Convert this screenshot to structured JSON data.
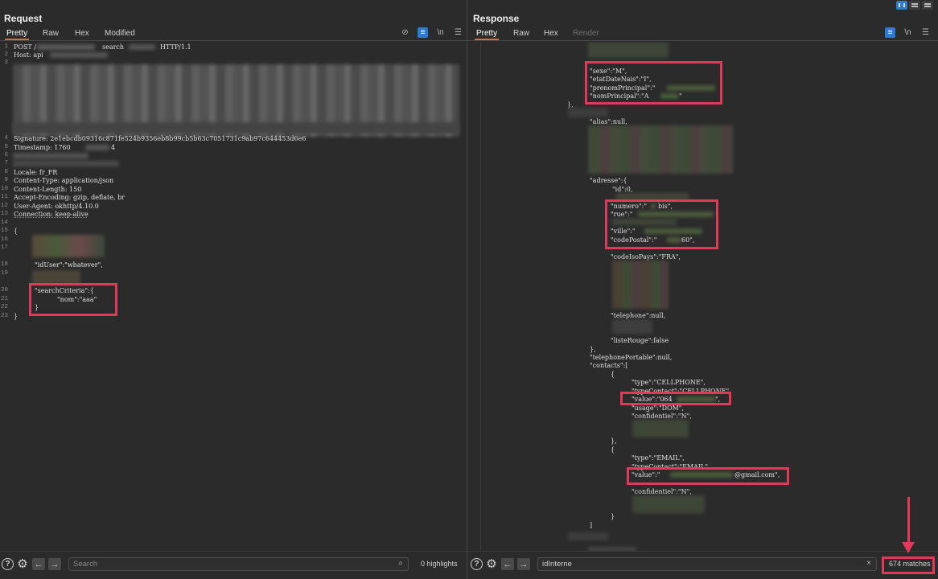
{
  "request": {
    "title": "Request",
    "tabs": [
      "Pretty",
      "Raw",
      "Hex",
      "Modified"
    ],
    "lines": {
      "l1": "POST /",
      "l1b": "search",
      "l1c": "HTTP/1.1",
      "l2": "Host: api",
      "l4": "Signature: 2e1ebcdb09316c871fe524b9356eb8b99cb5b63c7051731c9ab97c644453d6e6",
      "l5a": "Timestamp: 1760",
      "l5b": "4",
      "l8": "Locale: fr_FR",
      "l9": "Content-Type: application/json",
      "l10": "Content-Length: 150",
      "l11": "Accept-Encoding: gzip, deflate, br",
      "l12": "User-Agent: okhttp/4.10.0",
      "l13": "Connection: keep-alive",
      "l15": "{",
      "l18": "\"idUser\":\"whatever\",",
      "l20": "\"searchCriteria\":{",
      "l21": "\"nom\":\"aaa\"",
      "l22": "}",
      "l23": "}"
    },
    "line_numbers": [
      "1",
      "2",
      "3",
      "4",
      "5",
      "6",
      "7",
      "8",
      "9",
      "10",
      "11",
      "12",
      "13",
      "14",
      "15",
      "16",
      "17",
      "18",
      "19",
      "20",
      "21",
      "22",
      "23"
    ],
    "footer": {
      "search_placeholder": "Search",
      "highlights": "0 highlights"
    }
  },
  "response": {
    "title": "Response",
    "tabs": [
      "Pretty",
      "Raw",
      "Hex",
      "Render"
    ],
    "lines": {
      "sexe": "\"sexe\":\"M\",",
      "etat": "\"etatDateNais\":\"I\",",
      "prenom": "\"prenomPrincipal\":\"",
      "nom": "\"nomPrincipal\":\"A",
      "nom_end": "\"",
      "close1": "},",
      "alias": "\"alias\":null,",
      "adresse": "\"adresse\":{",
      "id": "\"id\":0,",
      "numero": "\"numero\":\"",
      "numero_b": "bis\",",
      "rue": "\"rue\":\"",
      "ville": "\"ville\":\"",
      "cp": "\"codePostal\":\"",
      "cp_b": "60\",",
      "iso": "\"codeIsoPays\":\"FRA\",",
      "tel": "\"telephone\":null,",
      "liste": "\"listeRouge\":false",
      "close2": "},",
      "telport": "\"telephonePortable\":null,",
      "contacts": "\"contacts\":[",
      "ob1": "{",
      "type1": "\"type\":\"CELLPHONE\",",
      "tc1": "\"typeContact\":\"CELLPHONE\",",
      "val1": "\"value\":\"064",
      "val1_end": "\",",
      "usage1": "\"usage\":\"DOM\",",
      "conf1": "\"confidentiel\":\"N\",",
      "cb1": "},",
      "ob2": "{",
      "type2": "\"type\":\"EMAIL\",",
      "tc2": "\"typeContact\":\"EMAIL\",",
      "val2": "\"value\":\"",
      "val2_end": "@gmail.com\",",
      "conf2": "\"confidentiel\":\"N\",",
      "cb2": "}",
      "close3": "]"
    },
    "footer": {
      "search_value": "idInterne",
      "matches": "674 matches"
    }
  }
}
